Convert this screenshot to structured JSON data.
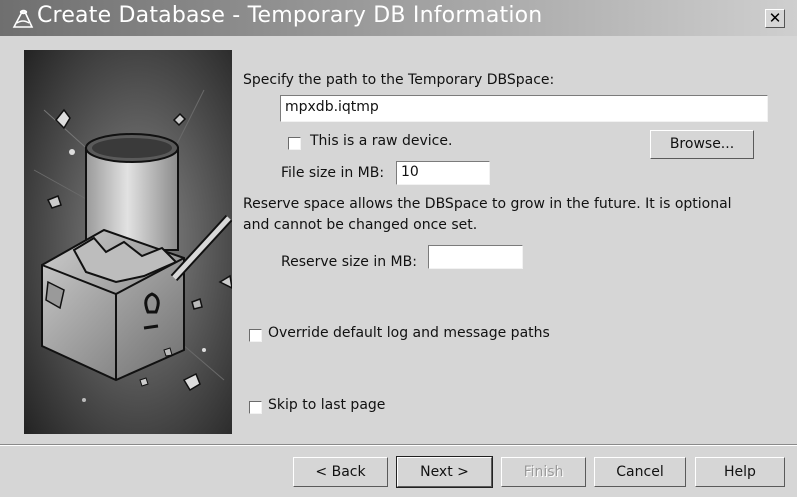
{
  "window": {
    "title": "Create Database - Temporary DB Information",
    "close_glyph": "✕",
    "icon": "database-wizard-icon"
  },
  "form": {
    "path_label": "Specify the path to the Temporary DBSpace:",
    "path_value": "mpxdb.iqtmp",
    "raw_device_label": "This is a raw device.",
    "raw_device_checked": false,
    "browse_label": "Browse...",
    "file_size_label": "File size in MB:",
    "file_size_value": "10",
    "reserve_note_line1": "Reserve space allows the DBSpace to grow in the future.  It is optional",
    "reserve_note_line2": "and cannot be changed once set.",
    "reserve_size_label": "Reserve size in MB:",
    "reserve_size_value": "",
    "override_label": "Override default log and message paths",
    "override_checked": false,
    "skip_label": "Skip to last page",
    "skip_checked": false
  },
  "footer": {
    "back_label": "< Back",
    "next_label": "Next >",
    "finish_label": "Finish",
    "cancel_label": "Cancel",
    "help_label": "Help"
  }
}
